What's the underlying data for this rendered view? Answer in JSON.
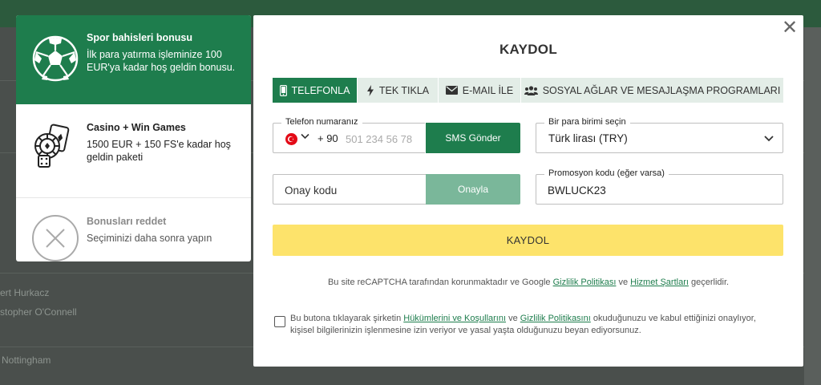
{
  "background": {
    "texts": [
      "ert Hurkacz",
      "stopher O'Connell",
      "Nottingham"
    ]
  },
  "bonuses": [
    {
      "icon": "soccer-ball-icon",
      "title": "Spor bahisleri bonusu",
      "description": "İlk para yatırma işleminize 100 EUR'ya kadar hoş geldin bonusu."
    },
    {
      "icon": "casino-chips-cards-icon",
      "title": "Casino + Win Games",
      "description": "1500 EUR + 150 FS'e kadar hoş geldin paketi"
    },
    {
      "icon": "close-circle-icon",
      "title": "Bonusları reddet",
      "description": "Seçiminizi daha sonra yapın"
    }
  ],
  "modal": {
    "title": "KAYDOL",
    "close_symbol": "✕",
    "tabs": [
      {
        "label": "TELEFONLA",
        "icon": "mobile-phone-icon",
        "active": true
      },
      {
        "label": "TEK TIKLA",
        "icon": "lightning-icon",
        "active": false
      },
      {
        "label": "E-MAIL İLE",
        "icon": "envelope-icon",
        "active": false
      },
      {
        "label": "SOSYAL AĞLAR VE MESAJLAŞMA PROGRAMLARI",
        "icon": "users-icon",
        "active": false
      }
    ],
    "phone": {
      "label": "Telefon numaranız",
      "country_code": "+ 90",
      "placeholder": "501 234 56 78",
      "sms_button": "SMS Gönder"
    },
    "currency": {
      "label": "Bir para birimi seçin",
      "value": "Türk lirası (TRY)"
    },
    "code": {
      "placeholder": "Onay kodu",
      "confirm_button": "Onayla"
    },
    "promo": {
      "label": "Promosyon kodu (eğer varsa)",
      "value": "BWLUCK23"
    },
    "submit_label": "KAYDOL",
    "recaptcha": {
      "prefix": "Bu site reCAPTCHA tarafından korunmaktadır ve Google ",
      "privacy_link": "Gizlilik Politikası",
      "and": " ve ",
      "terms_link": "Hizmet Şartları",
      "suffix": " geçerlidir."
    },
    "terms": {
      "prefix": "Bu butona tıklayarak şirketin ",
      "terms_link": "Hükümlerini ve Koşullarını",
      "and": " ve ",
      "privacy_link": "Gizlilik Politikasını",
      "suffix": " okuduğunuzu ve kabul ettiğinizi onaylıyor, kişisel bilgilerinizin işlenmesine izin veriyor ve yasal yaşta olduğunuzu beyan ediyorsunuz.",
      "checked": false
    }
  },
  "colors": {
    "brand_green": "#1e7d4d",
    "light_green": "#7ab79a",
    "submit_yellow": "#fde36b"
  }
}
